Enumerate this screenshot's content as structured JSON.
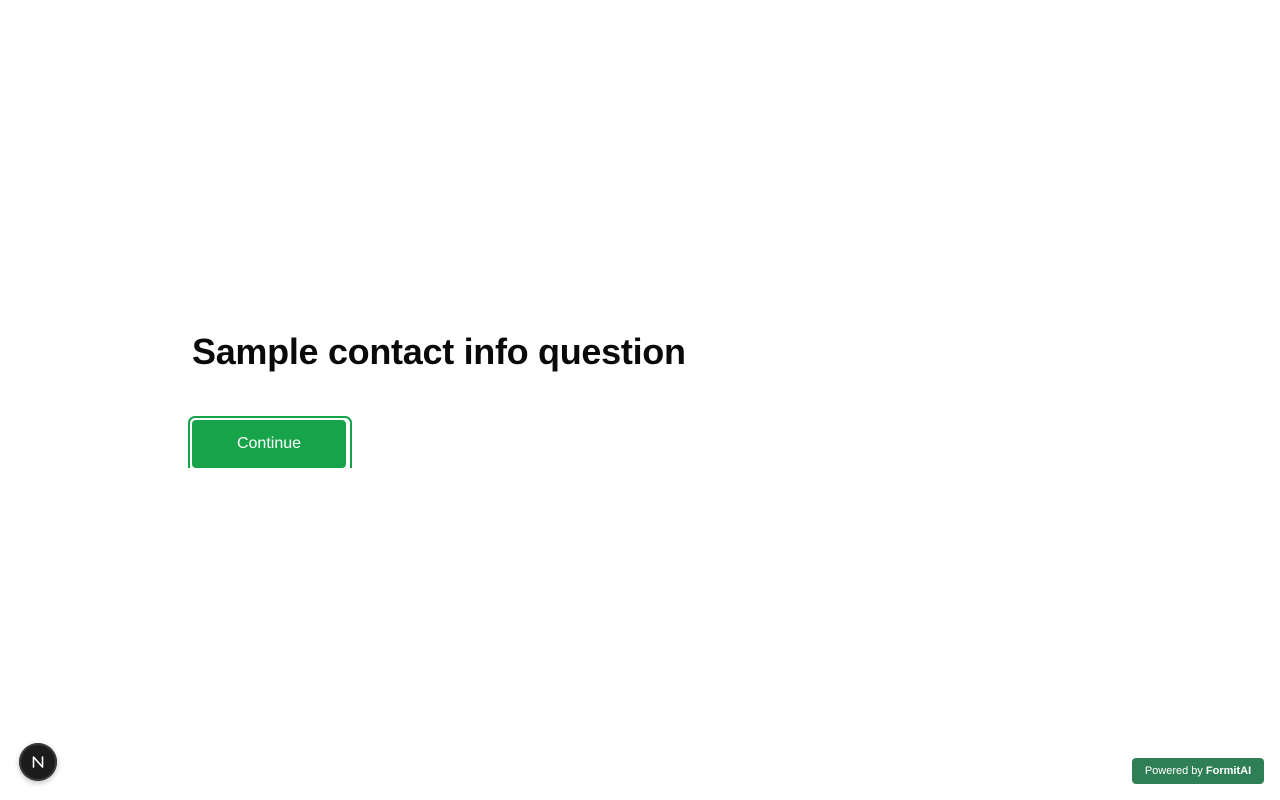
{
  "question": {
    "title": "Sample contact info question"
  },
  "actions": {
    "continue_label": "Continue"
  },
  "dev_indicator": {
    "icon": "n-letter-icon"
  },
  "footer": {
    "powered_by_prefix": "Powered by",
    "powered_by_brand": "FormitAI"
  },
  "colors": {
    "accent": "#16a34a",
    "badge": "#2f7f56",
    "indicator": "#1c1c1c",
    "text": "#0a0a0a"
  }
}
